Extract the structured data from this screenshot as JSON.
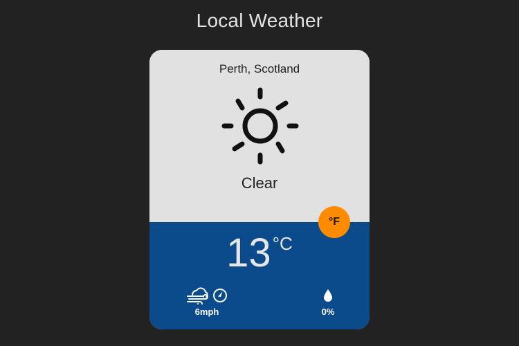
{
  "app": {
    "title": "Local Weather"
  },
  "weather": {
    "location": "Perth, Scotland",
    "condition": "Clear",
    "condition_icon": "sun-icon",
    "temperature": "13",
    "temperature_unit": "°C",
    "toggle_unit_label": "°F",
    "wind_speed": "6mph",
    "wind_icons": [
      "wind-cloud-icon",
      "wind-direction-icon"
    ],
    "precipitation": "0%",
    "precipitation_icon": "droplet-icon"
  },
  "colors": {
    "background": "#222222",
    "card_top": "#e1e1e1",
    "card_bottom": "#0b4a8b",
    "toggle_accent": "#ff8c00"
  }
}
